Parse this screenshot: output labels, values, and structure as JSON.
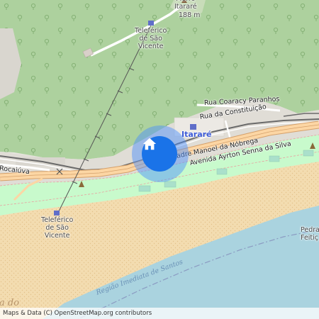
{
  "map": {
    "labels": {
      "peak_name": "Morro\nItararé",
      "peak_elevation": "188 m",
      "cable_top": "Teleférico\nde São\nVicente",
      "cable_bottom": "Teleférico\nde São\nVicente",
      "rua_coaracy": "Rua Coaracy Paranhos",
      "rua_constituicao": "Rua da Constituição",
      "place_itarare": "Itararé",
      "avenida_padre": "Padre Manoel da Nóbrega",
      "avenida_ayrton": "Avenida Ayrton Senna da Silva",
      "rocaiuva": "Rocaiúva",
      "pedra_feitic": "Pedra\nFeitiç",
      "regiao": "Região Imediata de Santos",
      "bay_partial": "a do"
    },
    "attribution": "Maps & Data (C) OpenStreetMap.org contributors",
    "marker_icon": "home-icon",
    "colors": {
      "forest": "#add19e",
      "beach": "#f3dcb0",
      "water": "#aad3df",
      "urban": "#e8e6e0",
      "road_primary": "#fcd6a4",
      "marker": "#1a73e8"
    }
  }
}
